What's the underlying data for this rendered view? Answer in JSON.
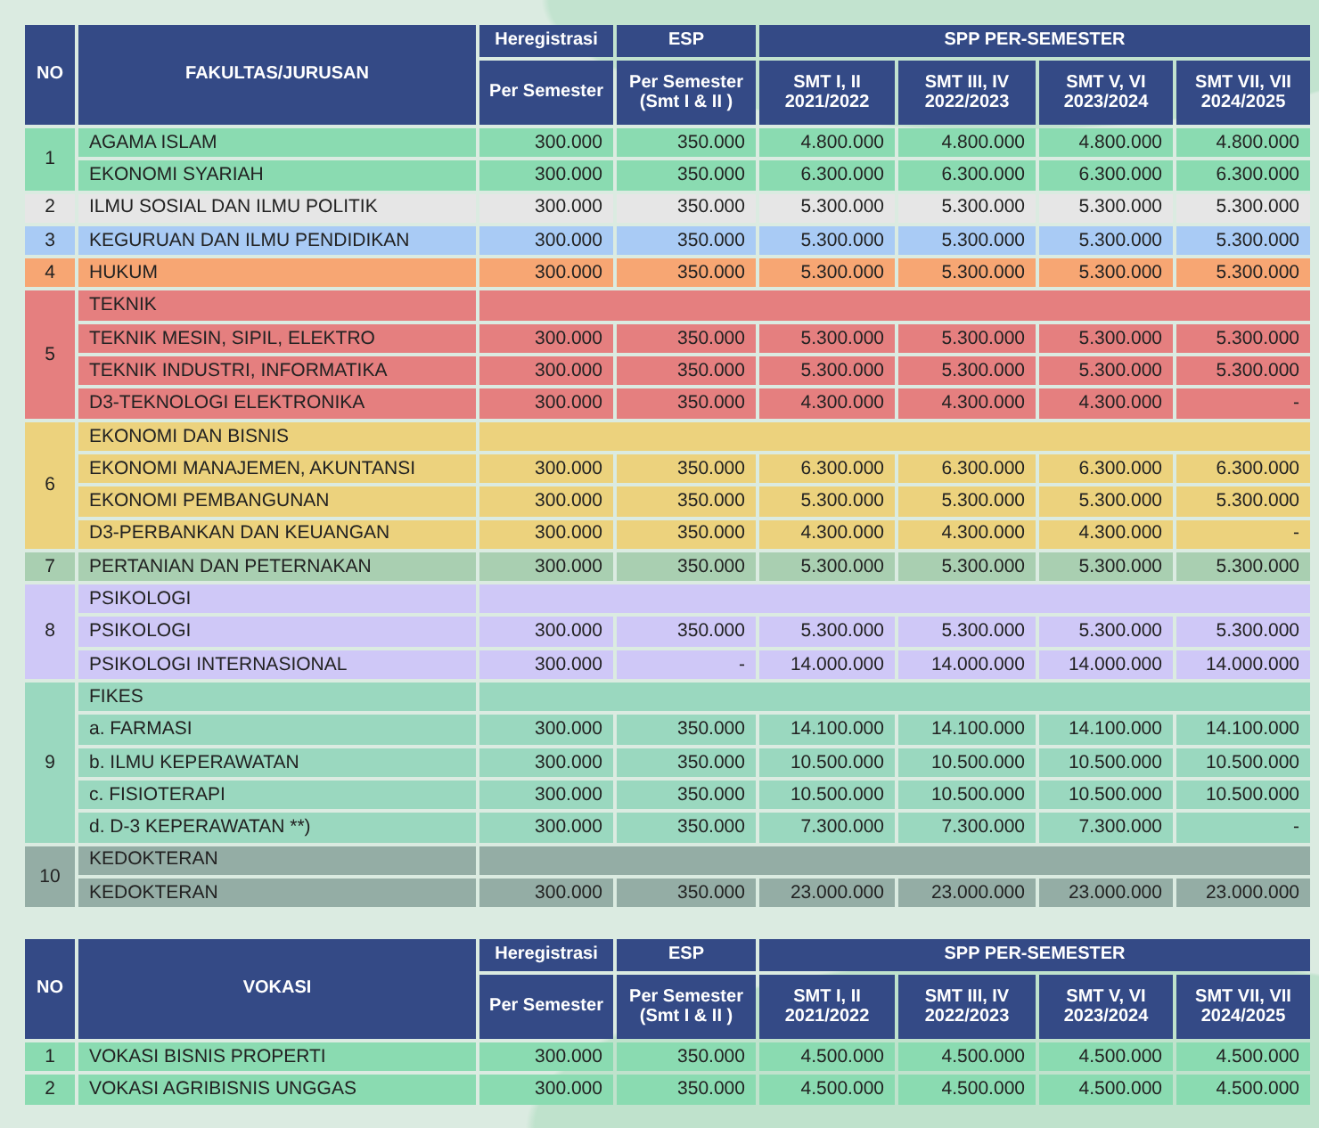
{
  "tables": [
    {
      "header": {
        "no": "NO",
        "name": "FAKULTAS/JURUSAN",
        "heregistrasi": "Heregistrasi",
        "esp": "ESP",
        "spp": "SPP PER-SEMESTER",
        "heregistrasi_sub": "Per Semester",
        "esp_sub": "Per Semester\n(Smt I & II )",
        "semesters": [
          "SMT I, II\n2021/2022",
          "SMT III, IV\n2022/2023",
          "SMT V, VI\n2023/2024",
          "SMT VII, VII\n2024/2025"
        ]
      },
      "groups": [
        {
          "no": "1",
          "color": "#8adbb1",
          "rows": [
            {
              "name": "AGAMA ISLAM",
              "heregistrasi": "300.000",
              "esp": "350.000",
              "spp": [
                "4.800.000",
                "4.800.000",
                "4.800.000",
                "4.800.000"
              ]
            },
            {
              "name": "EKONOMI SYARIAH",
              "heregistrasi": "300.000",
              "esp": "350.000",
              "spp": [
                "6.300.000",
                "6.300.000",
                "6.300.000",
                "6.300.000"
              ]
            }
          ]
        },
        {
          "no": "2",
          "color": "#e6e6e6",
          "rows": [
            {
              "name": "ILMU SOSIAL DAN ILMU POLITIK",
              "heregistrasi": "300.000",
              "esp": "350.000",
              "spp": [
                "5.300.000",
                "5.300.000",
                "5.300.000",
                "5.300.000"
              ]
            }
          ]
        },
        {
          "no": "3",
          "color": "#a9cbf5",
          "rows": [
            {
              "name": "KEGURUAN DAN ILMU PENDIDIKAN",
              "heregistrasi": "300.000",
              "esp": "350.000",
              "spp": [
                "5.300.000",
                "5.300.000",
                "5.300.000",
                "5.300.000"
              ]
            }
          ]
        },
        {
          "no": "4",
          "color": "#f7a673",
          "rows": [
            {
              "name": "HUKUM",
              "heregistrasi": "300.000",
              "esp": "350.000",
              "spp": [
                "5.300.000",
                "5.300.000",
                "5.300.000",
                "5.300.000"
              ]
            }
          ]
        },
        {
          "no": "5",
          "color": "#e57f7f",
          "heading": "TEKNIK",
          "rows": [
            {
              "name": "TEKNIK MESIN, SIPIL, ELEKTRO",
              "heregistrasi": "300.000",
              "esp": "350.000",
              "spp": [
                "5.300.000",
                "5.300.000",
                "5.300.000",
                "5.300.000"
              ]
            },
            {
              "name": "TEKNIK INDUSTRI, INFORMATIKA",
              "heregistrasi": "300.000",
              "esp": "350.000",
              "spp": [
                "5.300.000",
                "5.300.000",
                "5.300.000",
                "5.300.000"
              ]
            },
            {
              "name": "D3-TEKNOLOGI ELEKTRONIKA",
              "heregistrasi": "300.000",
              "esp": "350.000",
              "spp": [
                "4.300.000",
                "4.300.000",
                "4.300.000",
                "-"
              ]
            }
          ]
        },
        {
          "no": "6",
          "color": "#ecd27d",
          "heading": "EKONOMI DAN BISNIS",
          "rows": [
            {
              "name": "EKONOMI MANAJEMEN, AKUNTANSI",
              "heregistrasi": "300.000",
              "esp": "350.000",
              "spp": [
                "6.300.000",
                "6.300.000",
                "6.300.000",
                "6.300.000"
              ]
            },
            {
              "name": "EKONOMI PEMBANGUNAN",
              "heregistrasi": "300.000",
              "esp": "350.000",
              "spp": [
                "5.300.000",
                "5.300.000",
                "5.300.000",
                "5.300.000"
              ]
            },
            {
              "name": "D3-PERBANKAN DAN KEUANGAN",
              "heregistrasi": "300.000",
              "esp": "350.000",
              "spp": [
                "4.300.000",
                "4.300.000",
                "4.300.000",
                "-"
              ]
            }
          ]
        },
        {
          "no": "7",
          "color": "#a9cfb1",
          "rows": [
            {
              "name": "PERTANIAN DAN PETERNAKAN",
              "heregistrasi": "300.000",
              "esp": "350.000",
              "spp": [
                "5.300.000",
                "5.300.000",
                "5.300.000",
                "5.300.000"
              ]
            }
          ]
        },
        {
          "no": "8",
          "color": "#cfc8f7",
          "heading": "PSIKOLOGI",
          "rows": [
            {
              "name": "PSIKOLOGI",
              "heregistrasi": "300.000",
              "esp": "350.000",
              "spp": [
                "5.300.000",
                "5.300.000",
                "5.300.000",
                "5.300.000"
              ]
            },
            {
              "name": "PSIKOLOGI INTERNASIONAL",
              "heregistrasi": "300.000",
              "esp": "-",
              "spp": [
                "14.000.000",
                "14.000.000",
                "14.000.000",
                "14.000.000"
              ]
            }
          ]
        },
        {
          "no": "9",
          "color": "#9ad8bf",
          "heading": "FIKES",
          "rows": [
            {
              "name": "a. FARMASI",
              "heregistrasi": "300.000",
              "esp": "350.000",
              "spp": [
                "14.100.000",
                "14.100.000",
                "14.100.000",
                "14.100.000"
              ]
            },
            {
              "name": "b. ILMU KEPERAWATAN",
              "heregistrasi": "300.000",
              "esp": "350.000",
              "spp": [
                "10.500.000",
                "10.500.000",
                "10.500.000",
                "10.500.000"
              ]
            },
            {
              "name": "c. FISIOTERAPI",
              "heregistrasi": "300.000",
              "esp": "350.000",
              "spp": [
                "10.500.000",
                "10.500.000",
                "10.500.000",
                "10.500.000"
              ]
            },
            {
              "name": "d. D-3 KEPERAWATAN **)",
              "heregistrasi": "300.000",
              "esp": "350.000",
              "spp": [
                "7.300.000",
                "7.300.000",
                "7.300.000",
                "-"
              ]
            }
          ]
        },
        {
          "no": "10",
          "color": "#94ada5",
          "heading": "KEDOKTERAN",
          "rows": [
            {
              "name": "KEDOKTERAN",
              "heregistrasi": "300.000",
              "esp": "350.000",
              "spp": [
                "23.000.000",
                "23.000.000",
                "23.000.000",
                "23.000.000"
              ]
            }
          ]
        }
      ]
    },
    {
      "header": {
        "no": "NO",
        "name": "VOKASI",
        "heregistrasi": "Heregistrasi",
        "esp": "ESP",
        "spp": "SPP PER-SEMESTER",
        "heregistrasi_sub": "Per Semester",
        "esp_sub": "Per Semester\n(Smt I & II )",
        "semesters": [
          "SMT I, II\n2021/2022",
          "SMT III, IV\n2022/2023",
          "SMT V, VI\n2023/2024",
          "SMT VII, VII\n2024/2025"
        ]
      },
      "groups": [
        {
          "no": "1",
          "color": "#8adbb1",
          "rows": [
            {
              "name": "VOKASI BISNIS PROPERTI",
              "heregistrasi": "300.000",
              "esp": "350.000",
              "spp": [
                "4.500.000",
                "4.500.000",
                "4.500.000",
                "4.500.000"
              ]
            }
          ]
        },
        {
          "no": "2",
          "color": "#8adbb1",
          "rows": [
            {
              "name": "VOKASI AGRIBISNIS UNGGAS",
              "heregistrasi": "300.000",
              "esp": "350.000",
              "spp": [
                "4.500.000",
                "4.500.000",
                "4.500.000",
                "4.500.000"
              ]
            }
          ]
        }
      ]
    }
  ]
}
